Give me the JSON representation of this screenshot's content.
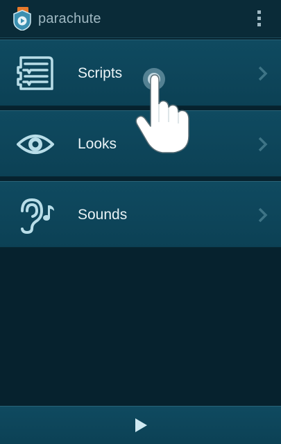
{
  "app": {
    "title": "parachute"
  },
  "menu": {
    "items": [
      {
        "label": "Scripts",
        "icon": "script-list-icon"
      },
      {
        "label": "Looks",
        "icon": "eye-icon"
      },
      {
        "label": "Sounds",
        "icon": "ear-music-icon"
      }
    ]
  },
  "bottom_bar": {
    "play_icon": "play-icon"
  },
  "colors": {
    "background": "#06222e",
    "item_background": "#0f4a60",
    "icon_color": "#b8dde8",
    "text_color": "#e9f3f6"
  }
}
